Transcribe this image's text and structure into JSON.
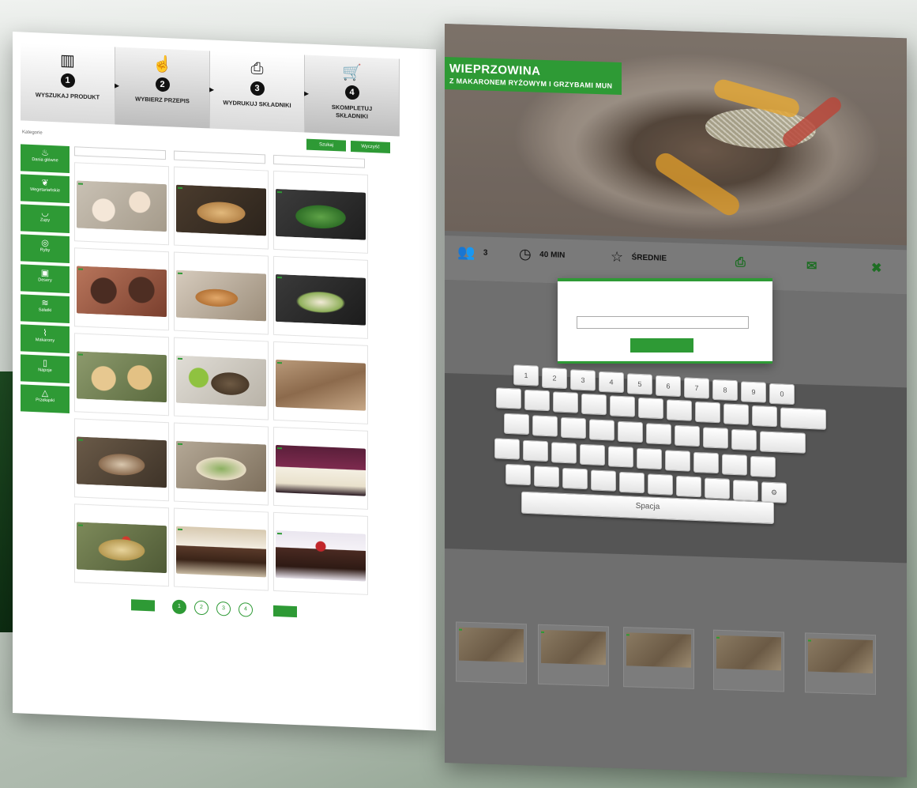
{
  "steps": [
    {
      "icon": "barcode-icon",
      "glyph": "▥",
      "num": "1",
      "label": "Wyszukaj produkt"
    },
    {
      "icon": "hand-icon",
      "glyph": "☝",
      "num": "2",
      "label": "Wybierz przepis"
    },
    {
      "icon": "printer-icon",
      "glyph": "⎙",
      "num": "3",
      "label": "Wydrukuj składniki"
    },
    {
      "icon": "cart-icon",
      "glyph": "🛒",
      "num": "4",
      "label": "Skompletuj składniki"
    }
  ],
  "filter": {
    "label": "Kategorie",
    "text": "",
    "btn1": "Szukaj",
    "btn2": "Wyczyść"
  },
  "sidebar": [
    {
      "icon": "dish-icon",
      "glyph": "♨",
      "label": "Dania główne"
    },
    {
      "icon": "leaf-icon",
      "glyph": "❦",
      "label": "Wegetariańskie"
    },
    {
      "icon": "bowl-icon",
      "glyph": "◡",
      "label": "Zupy"
    },
    {
      "icon": "fish-icon",
      "glyph": "◎",
      "label": "Ryby"
    },
    {
      "icon": "cake-icon",
      "glyph": "▣",
      "label": "Desery"
    },
    {
      "icon": "salad-icon",
      "glyph": "≋",
      "label": "Sałatki"
    },
    {
      "icon": "pasta-icon",
      "glyph": "⌇",
      "label": "Makarony"
    },
    {
      "icon": "glass-icon",
      "glyph": "▯",
      "label": "Napoje"
    },
    {
      "icon": "snack-icon",
      "glyph": "△",
      "label": "Przekąski"
    }
  ],
  "search": {
    "p1": "",
    "p2": "",
    "p3": ""
  },
  "cards": [
    {
      "title": "",
      "tag": "",
      "meta": ""
    },
    {
      "title": "",
      "tag": "",
      "meta": ""
    },
    {
      "title": "",
      "tag": "",
      "meta": ""
    },
    {
      "title": "",
      "tag": "",
      "meta": ""
    },
    {
      "title": "",
      "tag": "",
      "meta": ""
    },
    {
      "title": "",
      "tag": "",
      "meta": ""
    },
    {
      "title": "",
      "tag": "",
      "meta": ""
    },
    {
      "title": "",
      "tag": "",
      "meta": ""
    },
    {
      "title": "",
      "tag": "",
      "meta": ""
    },
    {
      "title": "",
      "tag": "",
      "meta": ""
    },
    {
      "title": "",
      "tag": "",
      "meta": ""
    },
    {
      "title": "",
      "tag": "",
      "meta": ""
    },
    {
      "title": "",
      "tag": "",
      "meta": ""
    },
    {
      "title": "",
      "tag": "",
      "meta": ""
    },
    {
      "title": "",
      "tag": "",
      "meta": ""
    }
  ],
  "pager": {
    "prev": "",
    "next": "",
    "pages": [
      "1",
      "2",
      "3",
      "4"
    ]
  },
  "left_footer": "",
  "recipe": {
    "title": "WIEPRZOWINA",
    "subtitle": "Z MAKARONEM RYŻOWYM I GRZYBAMI MUN",
    "servings": "3",
    "time": "40 MIN",
    "difficulty": "ŚREDNIE",
    "actions": [
      {
        "icon": "printer-icon",
        "glyph": "⎙",
        "label": ""
      },
      {
        "icon": "envelope-icon",
        "glyph": "✉",
        "label": ""
      },
      {
        "icon": "close-icon",
        "glyph": "✖",
        "label": ""
      }
    ]
  },
  "similar": {
    "heading": "",
    "cards": [
      {
        "title": "",
        "tag": "",
        "meta": ""
      },
      {
        "title": "",
        "tag": "",
        "meta": ""
      },
      {
        "title": "",
        "tag": "",
        "meta": ""
      },
      {
        "title": "",
        "tag": "",
        "meta": ""
      },
      {
        "title": "",
        "tag": "",
        "meta": ""
      }
    ]
  },
  "modal": {
    "label": "",
    "input_value": "",
    "send": ""
  },
  "keyboard": {
    "row1": [
      "1",
      "2",
      "3",
      "4",
      "5",
      "6",
      "7",
      "8",
      "9",
      "0"
    ],
    "space": "Spacja"
  },
  "colors": {
    "accent": "#2e9a35"
  }
}
